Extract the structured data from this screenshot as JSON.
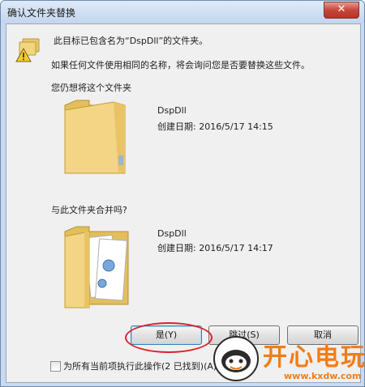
{
  "window": {
    "title": "确认文件夹替换",
    "close_symbol": "✕"
  },
  "message": {
    "line1": "此目标已包含名为“DspDll”的文件夹。",
    "line2": "如果任何文件使用相同的名称，将会询问您是否要替换这些文件。",
    "keep_prompt": "您仍想将这个文件夹",
    "merge_prompt": "与此文件夹合并吗?"
  },
  "destination_folder": {
    "name": "DspDll",
    "created": "创建日期: 2016/5/17 14:15"
  },
  "source_folder": {
    "name": "DspDll",
    "created": "创建日期: 2016/5/17 14:17"
  },
  "buttons": {
    "yes": "是(Y)",
    "skip": "跳过(S)",
    "cancel": "取消"
  },
  "checkbox": {
    "label": "为所有当前项执行此操作(2 已找到)(A)",
    "checked": false
  },
  "watermark": {
    "brand": "开心电玩",
    "url": "www.kxdw.com"
  },
  "colors": {
    "folder": "#f3d585",
    "highlight_ellipse": "#e0202a",
    "brand_orange": "#f07d18"
  }
}
